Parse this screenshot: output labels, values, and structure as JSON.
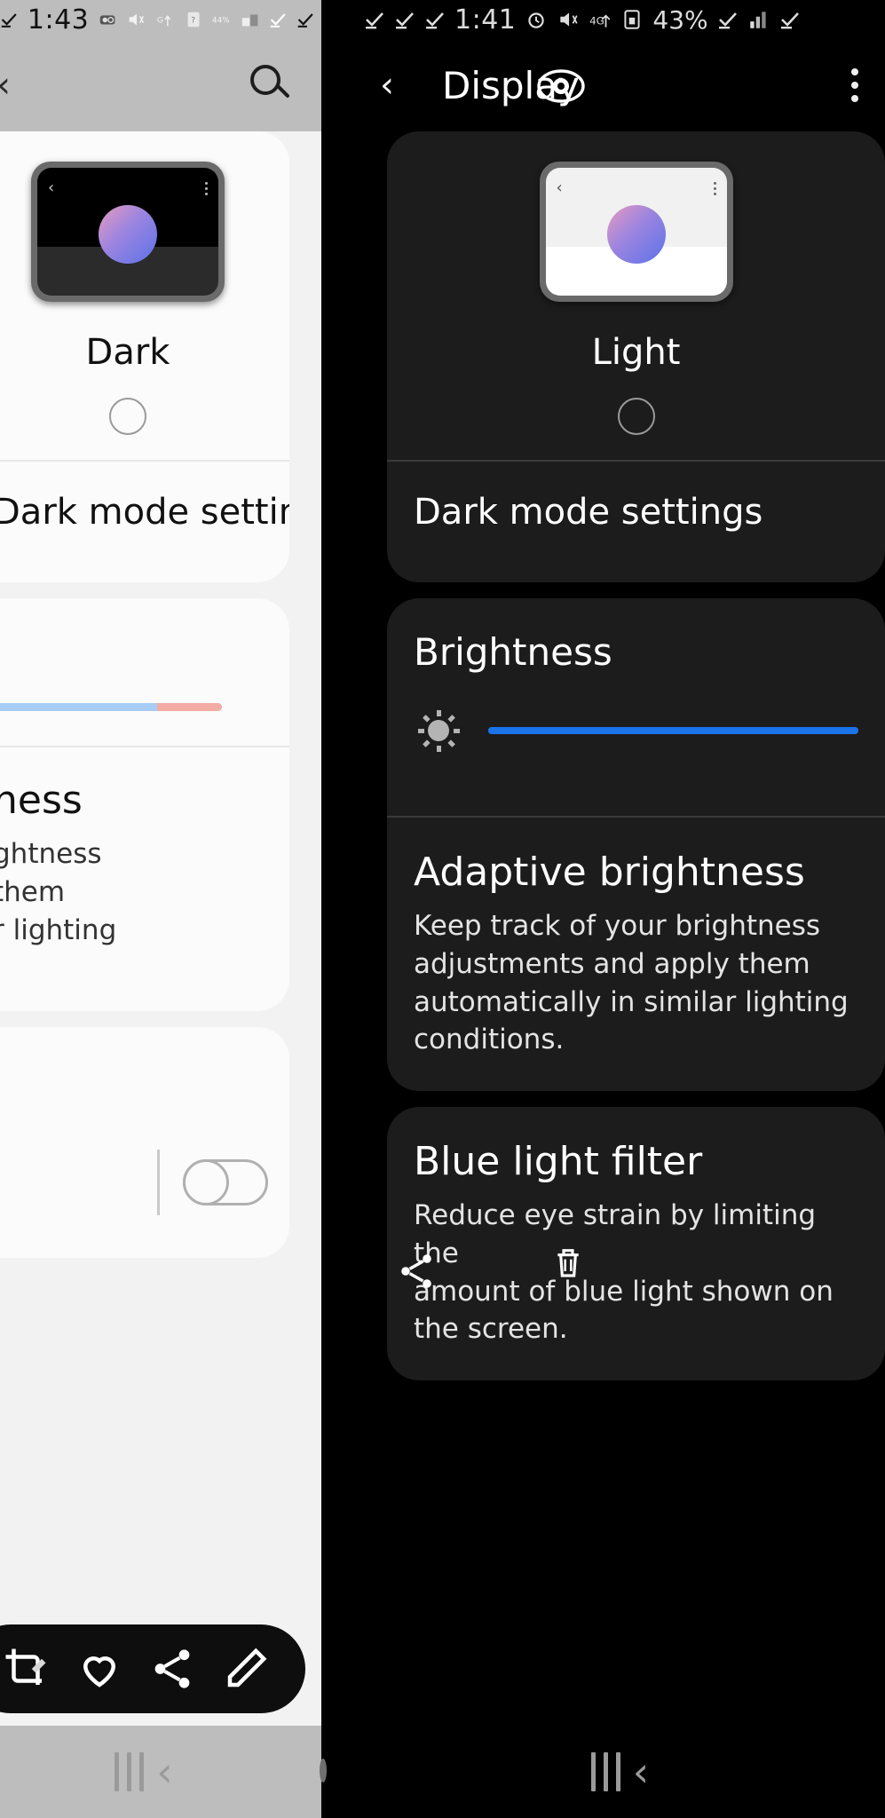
{
  "right_screen": {
    "statusbar": {
      "time": "1:41",
      "battery": "43%",
      "icons": [
        "check-icon",
        "check-icon",
        "check-icon",
        "check-icon",
        "alarm-icon",
        "mute-vibrate-icon",
        "four-g-plus-icon",
        "sim-card-icon",
        "signal-icon",
        "check-icon"
      ]
    },
    "titlebar": {
      "back": "‹",
      "title": "Display",
      "menu": "kebab-menu-icon",
      "eye_overlay": "eye-icon"
    },
    "theme": {
      "label": "Light",
      "selected": false
    },
    "dark_mode_row": "Dark mode settings",
    "brightness": {
      "title": "Brightness",
      "icon": "sun-icon",
      "value_percent": 100
    },
    "adaptive": {
      "title": "Adaptive brightness",
      "desc_lines": [
        "Keep track of your brightness",
        "adjustments and apply them",
        "automatically in similar lighting",
        "conditions."
      ]
    },
    "blue_light": {
      "title": "Blue light filter",
      "desc_lines": [
        "Reduce eye strain by limiting the",
        "amount of blue light shown on",
        "the screen."
      ]
    },
    "navbar": {
      "recents": "recents-icon",
      "back": "back-chevron-icon"
    }
  },
  "left_screen": {
    "statusbar": {
      "time": "1:43",
      "icons": [
        "check-icon",
        "check-icon",
        "alarm-icon",
        "mute-vibrate-icon",
        "four-g-plus-icon",
        "sim-card-icon",
        "forty-four-percent-icon",
        "signal-icon",
        "check-icon",
        "check-icon"
      ]
    },
    "titlebar": {
      "back": "‹",
      "search": "search-icon"
    },
    "theme": {
      "label": "Dark",
      "selected": false
    },
    "dark_mode_row": "Dark mode settings",
    "brightness_slider": {
      "cool_percent": 74,
      "warm_percent": 26,
      "knob_percent": 0
    },
    "adaptive": {
      "title_fragment": "ness",
      "desc_lines": [
        "ghtness",
        "them",
        "r lighting"
      ],
      "toggle_on": false
    },
    "action_pill": {
      "items": [
        "crop-icon",
        "heart-icon",
        "share-icon",
        "edit-pencil-icon"
      ]
    },
    "navbar": {
      "recents": "recents-icon",
      "back": "back-chevron-icon",
      "home": "home-circle-icon"
    }
  },
  "colors": {
    "accent_blue": "#1a73e8",
    "slider_cool": "#a8cdf5",
    "slider_warm": "#f2aca3",
    "dark_card": "#1c1c1c",
    "light_card": "#fbfbfb",
    "status_grey": "#bdbdbd"
  }
}
